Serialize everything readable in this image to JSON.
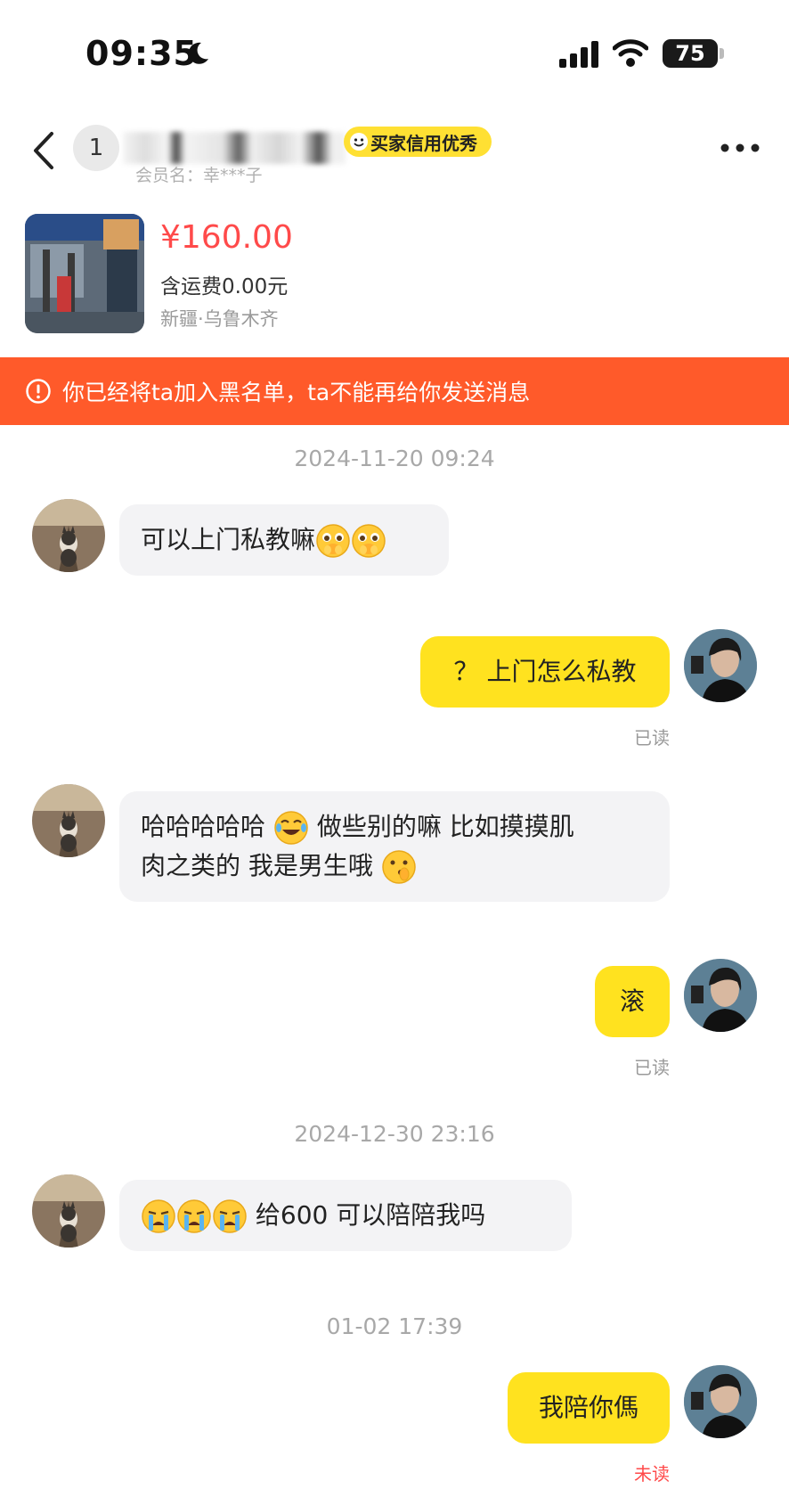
{
  "status_bar": {
    "time": "09:35",
    "battery": "75"
  },
  "header": {
    "name_initial": "1",
    "credit_badge": "买家信用优秀",
    "member_name": "会员名：幸***子"
  },
  "product": {
    "price": "¥160.00",
    "shipping": "含运费0.00元",
    "location": "新疆·乌鲁木齐"
  },
  "banner": {
    "text": "你已经将ta加入黑名单，ta不能再给你发送消息",
    "color": "#ff5a2a"
  },
  "colors": {
    "outgoing_bubble": "#ffe21f",
    "incoming_bubble": "#f3f3f5",
    "price": "#ff4a4a"
  },
  "messages": {
    "ts1": "2024-11-20 09:24",
    "m1": "可以上门私教嘛",
    "m2": "？ 上门怎么私教",
    "m2_status": "已读",
    "m3_a": "哈哈哈哈哈",
    "m3_b": "做些别的嘛 比如摸摸肌",
    "m3_c": "肉之类的 我是男生哦",
    "m4": "滚",
    "m4_status": "已读",
    "ts2": "2024-12-30 23:16",
    "m5": "给600  可以陪陪我吗",
    "ts3": "01-02 17:39",
    "m6": "我陪你傌",
    "m6_status": "未读"
  }
}
